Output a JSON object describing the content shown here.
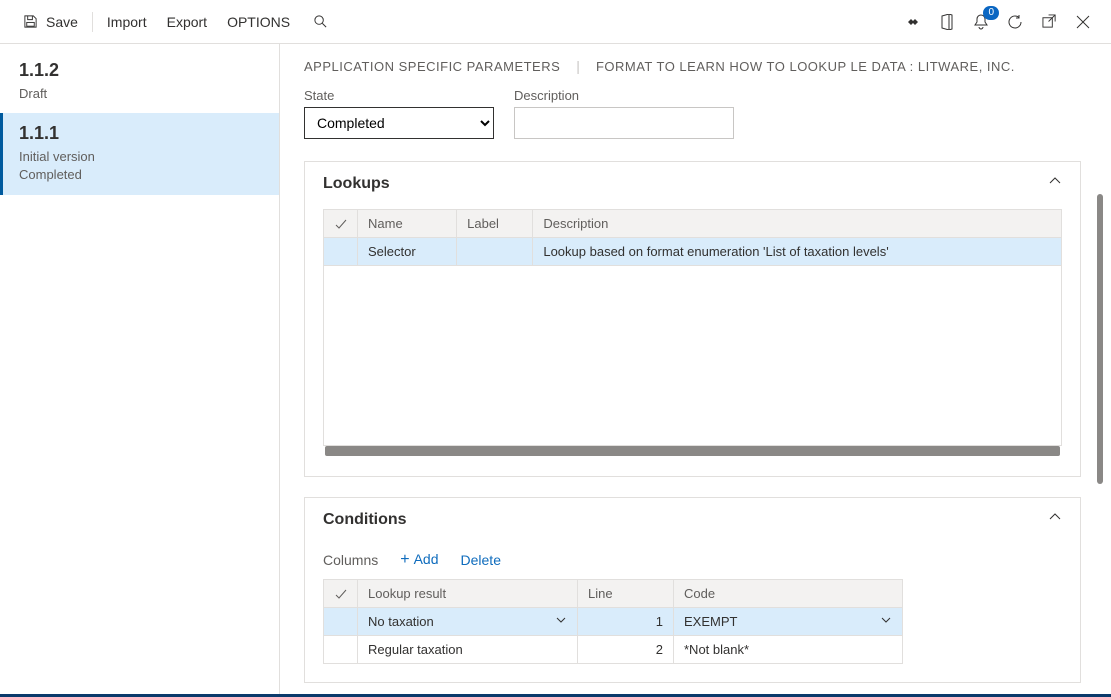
{
  "toolbar": {
    "save_label": "Save",
    "import_label": "Import",
    "export_label": "Export",
    "options_label": "OPTIONS"
  },
  "notifications_count": "0",
  "sidebar": {
    "items": [
      {
        "version": "1.1.2",
        "sub1": "Draft",
        "sub2": ""
      },
      {
        "version": "1.1.1",
        "sub1": "Initial version",
        "sub2": "Completed"
      }
    ]
  },
  "page_titles": {
    "left": "APPLICATION SPECIFIC PARAMETERS",
    "right": "FORMAT TO LEARN HOW TO LOOKUP LE DATA : LITWARE, INC."
  },
  "fields": {
    "state_label": "State",
    "state_value": "Completed",
    "description_label": "Description",
    "description_value": ""
  },
  "lookups": {
    "title": "Lookups",
    "columns": {
      "name": "Name",
      "label": "Label",
      "description": "Description"
    },
    "rows": [
      {
        "name": "Selector",
        "label": "",
        "description": "Lookup based on format enumeration 'List of taxation levels'"
      }
    ]
  },
  "conditions": {
    "title": "Conditions",
    "actions": {
      "columns": "Columns",
      "add": "Add",
      "delete": "Delete"
    },
    "columns": {
      "lookup_result": "Lookup result",
      "line": "Line",
      "code": "Code"
    },
    "rows": [
      {
        "lookup_result": "No taxation",
        "line": "1",
        "code": "EXEMPT"
      },
      {
        "lookup_result": "Regular taxation",
        "line": "2",
        "code": "*Not blank*"
      }
    ]
  }
}
